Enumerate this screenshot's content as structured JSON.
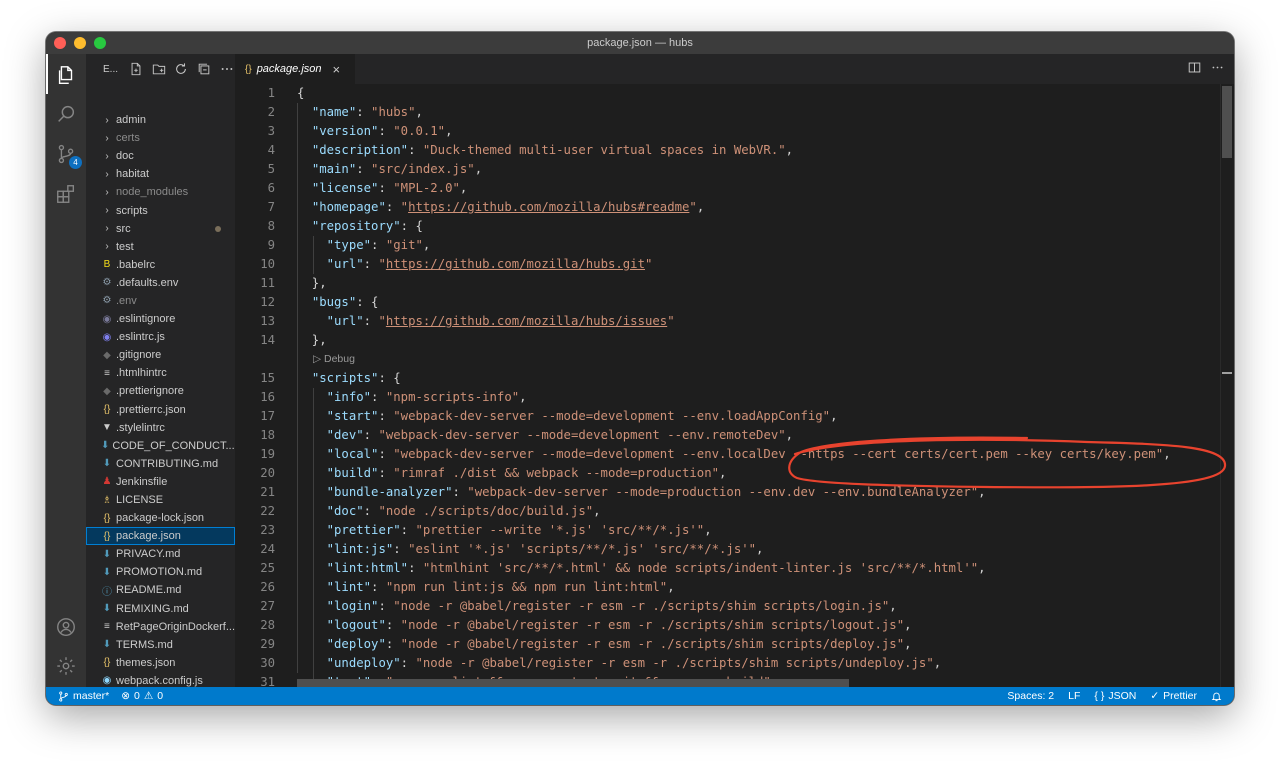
{
  "window": {
    "title": "package.json — hubs"
  },
  "activity_bar": {
    "items": [
      {
        "icon": "files-icon",
        "active": true
      },
      {
        "icon": "search-icon"
      },
      {
        "icon": "source-control-icon",
        "badge": "4"
      },
      {
        "icon": "extensions-icon"
      }
    ],
    "bottom": [
      {
        "icon": "account-icon"
      },
      {
        "icon": "gear-icon"
      }
    ]
  },
  "sidebar": {
    "title": "E...",
    "tree": [
      {
        "label": "admin",
        "type": "folder"
      },
      {
        "label": "certs",
        "type": "folder",
        "dim": true
      },
      {
        "label": "doc",
        "type": "folder"
      },
      {
        "label": "habitat",
        "type": "folder"
      },
      {
        "label": "node_modules",
        "type": "folder",
        "dim": true
      },
      {
        "label": "scripts",
        "type": "folder"
      },
      {
        "label": "src",
        "type": "folder",
        "modified": true
      },
      {
        "label": "test",
        "type": "folder"
      },
      {
        "label": ".babelrc",
        "icon": "B",
        "color": "#f5de19"
      },
      {
        "label": ".defaults.env",
        "icon": "⚙",
        "color": "#8a9aa8"
      },
      {
        "label": ".env",
        "icon": "⚙",
        "color": "#8a9aa8",
        "dim": true
      },
      {
        "label": ".eslintignore",
        "icon": "◉",
        "color": "#7a7a9a"
      },
      {
        "label": ".eslintrc.js",
        "icon": "◉",
        "color": "#8080f0"
      },
      {
        "label": ".gitignore",
        "icon": "◆",
        "color": "#6a6a6a"
      },
      {
        "label": ".htmlhintrc",
        "icon": "≡",
        "color": "#cccccc"
      },
      {
        "label": ".prettierignore",
        "icon": "◆",
        "color": "#6a6a6a"
      },
      {
        "label": ".prettierrc.json",
        "icon": "{}",
        "color": "#e8c46a"
      },
      {
        "label": ".stylelintrc",
        "icon": "▼",
        "color": "#cccccc"
      },
      {
        "label": "CODE_OF_CONDUCT....",
        "icon": "⬇",
        "color": "#519aba"
      },
      {
        "label": "CONTRIBUTING.md",
        "icon": "⬇",
        "color": "#519aba"
      },
      {
        "label": "Jenkinsfile",
        "icon": "♟",
        "color": "#d33833"
      },
      {
        "label": "LICENSE",
        "icon": "♗",
        "color": "#e8c46a"
      },
      {
        "label": "package-lock.json",
        "icon": "{}",
        "color": "#e8c46a"
      },
      {
        "label": "package.json",
        "icon": "{}",
        "color": "#e8c46a",
        "selected": true
      },
      {
        "label": "PRIVACY.md",
        "icon": "⬇",
        "color": "#519aba"
      },
      {
        "label": "PROMOTION.md",
        "icon": "⬇",
        "color": "#519aba"
      },
      {
        "label": "README.md",
        "icon": "ⓘ",
        "color": "#519aba"
      },
      {
        "label": "REMIXING.md",
        "icon": "⬇",
        "color": "#519aba"
      },
      {
        "label": "RetPageOriginDockerf...",
        "icon": "≡",
        "color": "#cccccc"
      },
      {
        "label": "TERMS.md",
        "icon": "⬇",
        "color": "#519aba"
      },
      {
        "label": "themes.json",
        "icon": "{}",
        "color": "#e8c46a"
      },
      {
        "label": "webpack.config.js",
        "icon": "◉",
        "color": "#8ed6fb"
      }
    ]
  },
  "tab": {
    "label": "package.json",
    "icon": "{}",
    "close": "×"
  },
  "editor_actions": [
    "split-editor-icon",
    "more-actions-icon"
  ],
  "codelens": "▷ Debug",
  "code_lines": [
    {
      "n": "1",
      "segs": [
        [
          "p",
          "{"
        ]
      ]
    },
    {
      "n": "2",
      "segs": [
        [
          "p",
          "  "
        ],
        [
          "k",
          "\"name\""
        ],
        [
          "p",
          ": "
        ],
        [
          "s",
          "\"hubs\""
        ],
        [
          "p",
          ","
        ]
      ]
    },
    {
      "n": "3",
      "segs": [
        [
          "p",
          "  "
        ],
        [
          "k",
          "\"version\""
        ],
        [
          "p",
          ": "
        ],
        [
          "s",
          "\"0.0.1\""
        ],
        [
          "p",
          ","
        ]
      ]
    },
    {
      "n": "4",
      "segs": [
        [
          "p",
          "  "
        ],
        [
          "k",
          "\"description\""
        ],
        [
          "p",
          ": "
        ],
        [
          "s",
          "\"Duck-themed multi-user virtual spaces in WebVR.\""
        ],
        [
          "p",
          ","
        ]
      ]
    },
    {
      "n": "5",
      "segs": [
        [
          "p",
          "  "
        ],
        [
          "k",
          "\"main\""
        ],
        [
          "p",
          ": "
        ],
        [
          "s",
          "\"src/index.js\""
        ],
        [
          "p",
          ","
        ]
      ]
    },
    {
      "n": "6",
      "segs": [
        [
          "p",
          "  "
        ],
        [
          "k",
          "\"license\""
        ],
        [
          "p",
          ": "
        ],
        [
          "s",
          "\"MPL-2.0\""
        ],
        [
          "p",
          ","
        ]
      ]
    },
    {
      "n": "7",
      "segs": [
        [
          "p",
          "  "
        ],
        [
          "k",
          "\"homepage\""
        ],
        [
          "p",
          ": "
        ],
        [
          "s",
          "\""
        ],
        [
          "u",
          "https://github.com/mozilla/hubs#readme"
        ],
        [
          "s",
          "\""
        ],
        [
          "p",
          ","
        ]
      ]
    },
    {
      "n": "8",
      "segs": [
        [
          "p",
          "  "
        ],
        [
          "k",
          "\"repository\""
        ],
        [
          "p",
          ": {"
        ]
      ]
    },
    {
      "n": "9",
      "segs": [
        [
          "p",
          "    "
        ],
        [
          "k",
          "\"type\""
        ],
        [
          "p",
          ": "
        ],
        [
          "s",
          "\"git\""
        ],
        [
          "p",
          ","
        ]
      ]
    },
    {
      "n": "10",
      "segs": [
        [
          "p",
          "    "
        ],
        [
          "k",
          "\"url\""
        ],
        [
          "p",
          ": "
        ],
        [
          "s",
          "\""
        ],
        [
          "u",
          "https://github.com/mozilla/hubs.git"
        ],
        [
          "s",
          "\""
        ]
      ]
    },
    {
      "n": "11",
      "segs": [
        [
          "p",
          "  },"
        ]
      ]
    },
    {
      "n": "12",
      "segs": [
        [
          "p",
          "  "
        ],
        [
          "k",
          "\"bugs\""
        ],
        [
          "p",
          ": {"
        ]
      ]
    },
    {
      "n": "13",
      "segs": [
        [
          "p",
          "    "
        ],
        [
          "k",
          "\"url\""
        ],
        [
          "p",
          ": "
        ],
        [
          "s",
          "\""
        ],
        [
          "u",
          "https://github.com/mozilla/hubs/issues"
        ],
        [
          "s",
          "\""
        ]
      ]
    },
    {
      "n": "14",
      "segs": [
        [
          "p",
          "  },"
        ]
      ]
    },
    {
      "n": "15",
      "segs": [
        [
          "p",
          "  "
        ],
        [
          "k",
          "\"scripts\""
        ],
        [
          "p",
          ": {"
        ]
      ]
    },
    {
      "n": "16",
      "segs": [
        [
          "p",
          "    "
        ],
        [
          "k",
          "\"info\""
        ],
        [
          "p",
          ": "
        ],
        [
          "s",
          "\"npm-scripts-info\""
        ],
        [
          "p",
          ","
        ]
      ]
    },
    {
      "n": "17",
      "segs": [
        [
          "p",
          "    "
        ],
        [
          "k",
          "\"start\""
        ],
        [
          "p",
          ": "
        ],
        [
          "s",
          "\"webpack-dev-server --mode=development --env.loadAppConfig\""
        ],
        [
          "p",
          ","
        ]
      ]
    },
    {
      "n": "18",
      "segs": [
        [
          "p",
          "    "
        ],
        [
          "k",
          "\"dev\""
        ],
        [
          "p",
          ": "
        ],
        [
          "s",
          "\"webpack-dev-server --mode=development --env.remoteDev\""
        ],
        [
          "p",
          ","
        ]
      ]
    },
    {
      "n": "19",
      "segs": [
        [
          "p",
          "    "
        ],
        [
          "k",
          "\"local\""
        ],
        [
          "p",
          ": "
        ],
        [
          "s",
          "\"webpack-dev-server --mode=development --env.localDev --https --cert certs/cert.pem --key certs/key.pem\""
        ],
        [
          "p",
          ","
        ]
      ]
    },
    {
      "n": "20",
      "segs": [
        [
          "p",
          "    "
        ],
        [
          "k",
          "\"build\""
        ],
        [
          "p",
          ": "
        ],
        [
          "s",
          "\"rimraf ./dist && webpack --mode=production\""
        ],
        [
          "p",
          ","
        ]
      ]
    },
    {
      "n": "21",
      "segs": [
        [
          "p",
          "    "
        ],
        [
          "k",
          "\"bundle-analyzer\""
        ],
        [
          "p",
          ": "
        ],
        [
          "s",
          "\"webpack-dev-server --mode=production --env.dev --env.bundleAnalyzer\""
        ],
        [
          "p",
          ","
        ]
      ]
    },
    {
      "n": "22",
      "segs": [
        [
          "p",
          "    "
        ],
        [
          "k",
          "\"doc\""
        ],
        [
          "p",
          ": "
        ],
        [
          "s",
          "\"node ./scripts/doc/build.js\""
        ],
        [
          "p",
          ","
        ]
      ]
    },
    {
      "n": "23",
      "segs": [
        [
          "p",
          "    "
        ],
        [
          "k",
          "\"prettier\""
        ],
        [
          "p",
          ": "
        ],
        [
          "s",
          "\"prettier --write '*.js' 'src/**/*.js'\""
        ],
        [
          "p",
          ","
        ]
      ]
    },
    {
      "n": "24",
      "segs": [
        [
          "p",
          "    "
        ],
        [
          "k",
          "\"lint:js\""
        ],
        [
          "p",
          ": "
        ],
        [
          "s",
          "\"eslint '*.js' 'scripts/**/*.js' 'src/**/*.js'\""
        ],
        [
          "p",
          ","
        ]
      ]
    },
    {
      "n": "25",
      "segs": [
        [
          "p",
          "    "
        ],
        [
          "k",
          "\"lint:html\""
        ],
        [
          "p",
          ": "
        ],
        [
          "s",
          "\"htmlhint 'src/**/*.html' && node scripts/indent-linter.js 'src/**/*.html'\""
        ],
        [
          "p",
          ","
        ]
      ]
    },
    {
      "n": "26",
      "segs": [
        [
          "p",
          "    "
        ],
        [
          "k",
          "\"lint\""
        ],
        [
          "p",
          ": "
        ],
        [
          "s",
          "\"npm run lint:js && npm run lint:html\""
        ],
        [
          "p",
          ","
        ]
      ]
    },
    {
      "n": "27",
      "segs": [
        [
          "p",
          "    "
        ],
        [
          "k",
          "\"login\""
        ],
        [
          "p",
          ": "
        ],
        [
          "s",
          "\"node -r @babel/register -r esm -r ./scripts/shim scripts/login.js\""
        ],
        [
          "p",
          ","
        ]
      ]
    },
    {
      "n": "28",
      "segs": [
        [
          "p",
          "    "
        ],
        [
          "k",
          "\"logout\""
        ],
        [
          "p",
          ": "
        ],
        [
          "s",
          "\"node -r @babel/register -r esm -r ./scripts/shim scripts/logout.js\""
        ],
        [
          "p",
          ","
        ]
      ]
    },
    {
      "n": "29",
      "segs": [
        [
          "p",
          "    "
        ],
        [
          "k",
          "\"deploy\""
        ],
        [
          "p",
          ": "
        ],
        [
          "s",
          "\"node -r @babel/register -r esm -r ./scripts/shim scripts/deploy.js\""
        ],
        [
          "p",
          ","
        ]
      ]
    },
    {
      "n": "30",
      "segs": [
        [
          "p",
          "    "
        ],
        [
          "k",
          "\"undeploy\""
        ],
        [
          "p",
          ": "
        ],
        [
          "s",
          "\"node -r @babel/register -r esm -r ./scripts/shim scripts/undeploy.js\""
        ],
        [
          "p",
          ","
        ]
      ]
    },
    {
      "n": "31",
      "segs": [
        [
          "p",
          "    "
        ],
        [
          "k",
          "\"test\""
        ],
        [
          "p",
          ": "
        ],
        [
          "s",
          "\"npm run lint && npm run test:unit && npm run build\""
        ],
        [
          "p",
          ","
        ]
      ]
    }
  ],
  "statusbar": {
    "branch": "master*",
    "errors": "0",
    "warnings": "0",
    "spaces": "Spaces: 2",
    "eol": "LF",
    "language": "JSON",
    "formatter": "Prettier"
  },
  "colors": {
    "accent": "#007acc",
    "annotation": "#e8432e",
    "key": "#9cdcfe",
    "string": "#ce9178"
  }
}
